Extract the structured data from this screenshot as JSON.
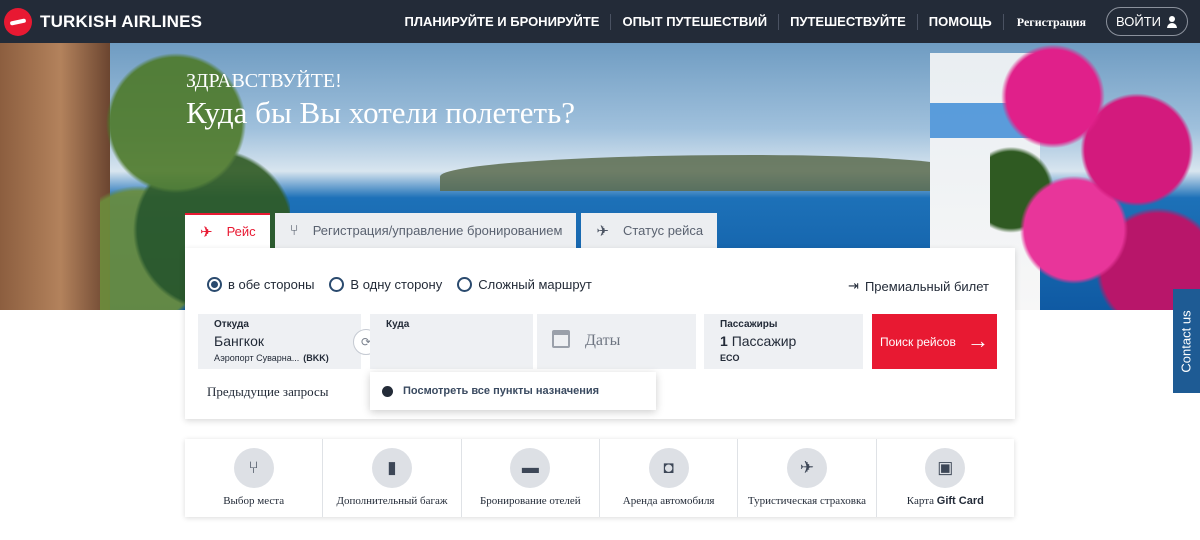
{
  "header": {
    "brand": "TURKISH AIRLINES",
    "nav": [
      "ПЛАНИРУЙТЕ И БРОНИРУЙТЕ",
      "ОПЫТ ПУТЕШЕСТВИЙ",
      "ПУТЕШЕСТВУЙТЕ",
      "ПОМОЩЬ"
    ],
    "register": "Регистрация",
    "login": "ВОЙТИ",
    "icons": {
      "logo": "turkish-airlines-logo",
      "user": "user-icon"
    },
    "colors": {
      "bg": "#232b38",
      "brand_red": "#e81932"
    }
  },
  "hero": {
    "greeting": "ЗДРАВСТВУЙТЕ!",
    "title": "Куда бы Вы хотели полететь?"
  },
  "tabs": [
    {
      "label": "Рейс",
      "icon": "plane-icon",
      "active": true
    },
    {
      "label": "Регистрация/управление бронированием",
      "icon": "seat-icon",
      "active": false
    },
    {
      "label": "Статус рейса",
      "icon": "flight-status-icon",
      "active": false
    }
  ],
  "booking": {
    "trip_types": [
      {
        "label": "в обе стороны",
        "selected": true
      },
      {
        "label": "В одну сторону",
        "selected": false
      },
      {
        "label": "Сложный маршрут",
        "selected": false
      }
    ],
    "premium": "Премиальный билет",
    "from": {
      "label": "Откуда",
      "value": "Бангкок",
      "airport": "Аэропорт Суварна...",
      "code": "(BKK)"
    },
    "to": {
      "label": "Куда",
      "value": ""
    },
    "dates": {
      "placeholder": "Даты"
    },
    "passengers": {
      "label": "Пассажиры",
      "count": "1",
      "unit": "Пассажир",
      "class": "ECO"
    },
    "search": "Поиск рейсов",
    "previous": "Предыдущие запросы",
    "dropdown": "Посмотреть все пункты назначения"
  },
  "services": [
    {
      "label": "Выбор места",
      "icon": "seat-select-icon"
    },
    {
      "label": "Дополнительный багаж",
      "icon": "baggage-icon"
    },
    {
      "label": "Бронирование отелей",
      "icon": "hotel-bed-icon"
    },
    {
      "label": "Аренда автомобиля",
      "icon": "car-icon"
    },
    {
      "label": "Туристическая страховка",
      "icon": "insurance-shield-icon"
    },
    {
      "label_prefix": "Карта",
      "label_bold": "Gift Card",
      "icon": "gift-icon"
    }
  ],
  "contact": "Contact us"
}
